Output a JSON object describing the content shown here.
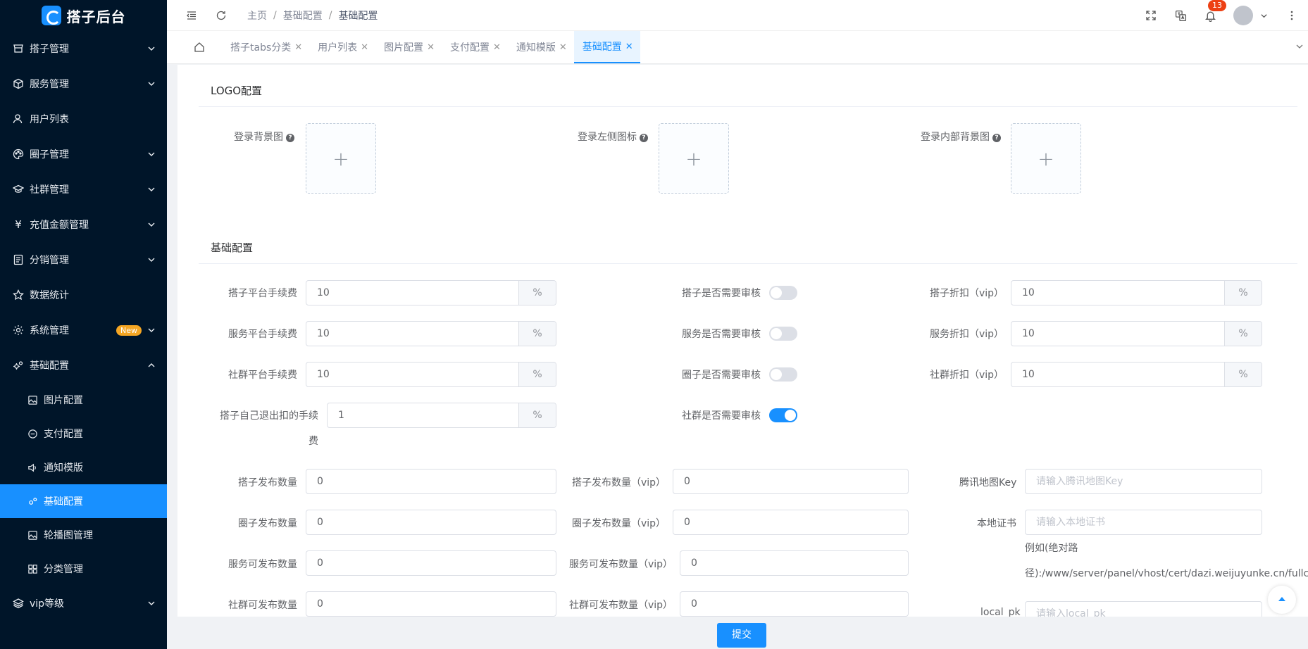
{
  "app": {
    "title": "搭子后台"
  },
  "sidebar": {
    "items": [
      {
        "label": "搭子管理",
        "icon": "shop-icon",
        "expandable": true
      },
      {
        "label": "服务管理",
        "icon": "cube-icon",
        "expandable": true
      },
      {
        "label": "用户列表",
        "icon": "user-icon",
        "expandable": false
      },
      {
        "label": "圈子管理",
        "icon": "palette-icon",
        "expandable": true
      },
      {
        "label": "社群管理",
        "icon": "graduation-icon",
        "expandable": true
      },
      {
        "label": "充值金额管理",
        "icon": "yen-icon",
        "expandable": true
      },
      {
        "label": "分销管理",
        "icon": "document-icon",
        "expandable": true
      },
      {
        "label": "数据统计",
        "icon": "star-icon",
        "expandable": false
      },
      {
        "label": "系统管理",
        "icon": "gear-icon",
        "expandable": true,
        "badge": "New"
      },
      {
        "label": "基础配置",
        "icon": "gears-icon",
        "expandable": true,
        "open": true
      },
      {
        "label": "vip等级",
        "icon": "layers-icon",
        "expandable": true
      }
    ],
    "sub_items": [
      {
        "label": "图片配置",
        "icon": "image-icon"
      },
      {
        "label": "支付配置",
        "icon": "minus-circle-icon"
      },
      {
        "label": "通知模版",
        "icon": "speaker-icon"
      },
      {
        "label": "基础配置",
        "icon": "gears-icon",
        "active": true
      },
      {
        "label": "轮播图管理",
        "icon": "image-icon"
      },
      {
        "label": "分类管理",
        "icon": "grid-icon"
      }
    ]
  },
  "header": {
    "breadcrumb": [
      "主页",
      "基础配置",
      "基础配置"
    ],
    "notification_count": "13"
  },
  "tabs": [
    {
      "label": "搭子tabs分类"
    },
    {
      "label": "用户列表"
    },
    {
      "label": "图片配置"
    },
    {
      "label": "支付配置"
    },
    {
      "label": "通知模版"
    },
    {
      "label": "基础配置",
      "active": true
    }
  ],
  "logo_section": {
    "title": "LOGO配置",
    "uploads": [
      {
        "label": "登录背景图"
      },
      {
        "label": "登录左侧图标"
      },
      {
        "label": "登录内部背景图"
      }
    ]
  },
  "basic_section": {
    "title": "基础配置",
    "fees": [
      {
        "label": "搭子平台手续费",
        "value": "10",
        "unit": "%"
      },
      {
        "label": "服务平台手续费",
        "value": "10",
        "unit": "%"
      },
      {
        "label": "社群平台手续费",
        "value": "10",
        "unit": "%"
      },
      {
        "label": "搭子自己退出扣的手续",
        "label2": "费",
        "value": "1",
        "unit": "%"
      }
    ],
    "reviews": [
      {
        "label": "搭子是否需要审核",
        "on": false
      },
      {
        "label": "服务是否需要审核",
        "on": false
      },
      {
        "label": "圈子是否需要审核",
        "on": false
      },
      {
        "label": "社群是否需要审核",
        "on": true
      }
    ],
    "discounts": [
      {
        "label": "搭子折扣（vip）",
        "value": "10",
        "unit": "%"
      },
      {
        "label": "服务折扣（vip）",
        "value": "10",
        "unit": "%"
      },
      {
        "label": "社群折扣（vip）",
        "value": "10",
        "unit": "%"
      }
    ],
    "counts": [
      {
        "label": "搭子发布数量",
        "value": "0"
      },
      {
        "label": "圈子发布数量",
        "value": "0"
      },
      {
        "label": "服务可发布数量",
        "value": "0"
      },
      {
        "label": "社群可发布数量",
        "value": "0"
      }
    ],
    "vip_counts": [
      {
        "label": "搭子发布数量（vip）",
        "value": "0"
      },
      {
        "label": "圈子发布数量（vip）",
        "value": "0"
      },
      {
        "label": "服务可发布数量（vip）",
        "value": "0"
      },
      {
        "label": "社群可发布数量（vip）",
        "value": "0"
      }
    ],
    "tencent_key": {
      "label": "腾讯地图Key",
      "placeholder": "请输入腾讯地图Key"
    },
    "local_cert": {
      "label": "本地证书",
      "placeholder": "请输入本地证书",
      "hint1": "例如(绝对路",
      "hint2": "径):/www/server/panel/vhost/cert/dazi.weijuyunke.cn/fullch"
    },
    "local_pk": {
      "label": "local_pk",
      "placeholder": "请输入local_pk"
    }
  },
  "submit_label": "提交",
  "colors": {
    "primary": "#1890ff",
    "sidebar_bg": "#001529",
    "badge_new": "#f5a623",
    "badge_red": "#ed4014"
  }
}
